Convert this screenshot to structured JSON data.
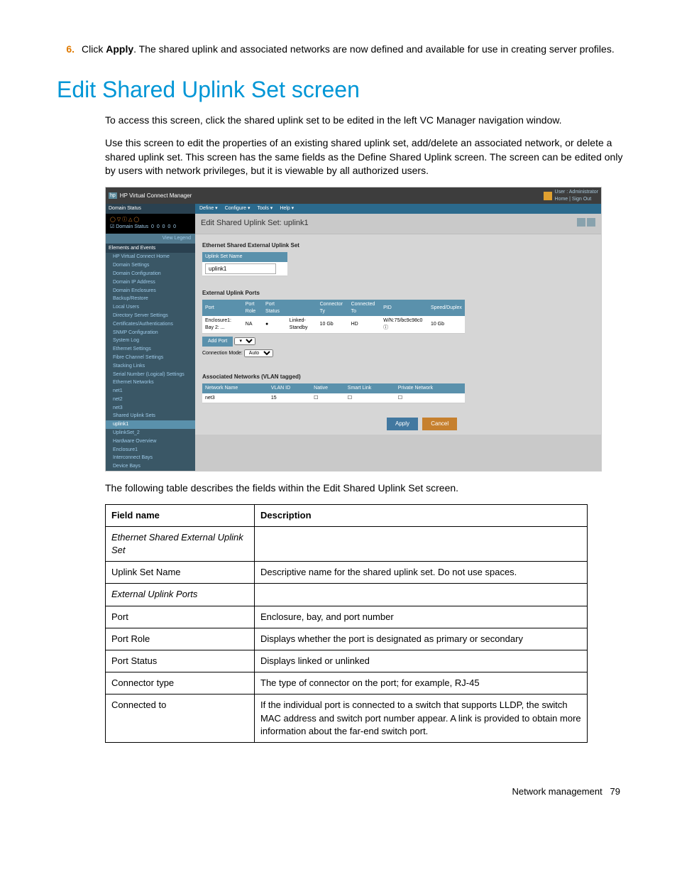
{
  "step": {
    "num": "6.",
    "prefix": "Click ",
    "bold": "Apply",
    "suffix": ". The shared uplink and associated networks are now defined and available for use in creating server profiles."
  },
  "heading": "Edit Shared Uplink Set screen",
  "para1": "To access this screen, click the shared uplink set to be edited in the left VC Manager navigation window.",
  "para2": "Use this screen to edit the properties of an existing shared uplink set, add/delete an associated network, or delete a shared uplink set. This screen has the same fields as the Define Shared Uplink screen. The screen can be edited only by users with network privileges, but it is viewable by all authorized users.",
  "ss": {
    "app": "HP Virtual Connect Manager",
    "user_label": "User : Administrator",
    "user_links": "Home | Sign Out",
    "menus": [
      "Define ▾",
      "Configure ▾",
      "Tools ▾",
      "Help ▾"
    ],
    "side_domain_hdr": "Domain Status",
    "side_domain_row": "Domain Status",
    "view_legend": "View Legend",
    "side_events_hdr": "Elements and Events",
    "nav": [
      "HP Virtual Connect Home",
      "Domain Settings",
      "Domain Configuration",
      "Domain IP Address",
      "Domain Enclosures",
      "Backup/Restore",
      "Local Users",
      "Directory Server Settings",
      "Certificates/Authentications",
      "SNMP Configuration",
      "System Log",
      "Ethernet Settings",
      "Fibre Channel Settings",
      "Stacking Links",
      "Serial Number (Logical) Settings",
      "Ethernet Networks",
      "net1",
      "net2",
      "net3",
      "Shared Uplink Sets",
      "uplink1",
      "UplinkSet_2",
      "Hardware Overview",
      "Enclosure1",
      "Interconnect Bays",
      "Device Bays"
    ],
    "page_title": "Edit Shared Uplink Set: uplink1",
    "sec1": "Ethernet Shared External Uplink Set",
    "name_label": "Uplink Set Name",
    "name_value": "uplink1",
    "sec2": "External Uplink Ports",
    "ports_hdr": [
      "Port",
      "Port Role",
      "Port Status",
      "",
      "Connector Ty",
      "Connected To",
      "PID",
      "Speed/Duplex"
    ],
    "ports_row": [
      "Enclosure1: Bay 2: ...",
      "NA",
      "●",
      "Linked-Standby",
      "10 Gb",
      "HD",
      "W/N:75/bc9c98c0 ⓘ",
      "10 Gb"
    ],
    "add_port": "Add Port",
    "conn_mode_label": "Connection Mode:",
    "conn_mode_value": "Auto",
    "sec3": "Associated Networks (VLAN tagged)",
    "assoc_hdr": [
      "Network Name",
      "VLAN ID",
      "Native",
      "Smart Link",
      "Private Network"
    ],
    "assoc_row": [
      "net3",
      "15",
      "☐",
      "☐",
      "☐"
    ],
    "apply": "Apply",
    "cancel": "Cancel"
  },
  "para3": "The following table describes the fields within the Edit Shared Uplink Set screen.",
  "table": {
    "headers": [
      "Field name",
      "Description"
    ],
    "rows": [
      {
        "f": "Ethernet Shared External Uplink Set",
        "d": "",
        "italic": true
      },
      {
        "f": "Uplink Set Name",
        "d": "Descriptive name for the shared uplink set. Do not use spaces."
      },
      {
        "f": "External Uplink Ports",
        "d": "",
        "italic": true
      },
      {
        "f": "Port",
        "d": "Enclosure, bay, and port number"
      },
      {
        "f": "Port Role",
        "d": "Displays whether the port is designated as primary or secondary"
      },
      {
        "f": "Port Status",
        "d": "Displays linked or unlinked"
      },
      {
        "f": "Connector type",
        "d": "The type of connector on the port; for example, RJ-45"
      },
      {
        "f": "Connected to",
        "d": "If the individual port is connected to a switch that supports LLDP, the switch MAC address and switch port number appear. A link is provided to obtain more information about the far-end switch port."
      }
    ]
  },
  "footer": {
    "section": "Network management",
    "page": "79"
  }
}
